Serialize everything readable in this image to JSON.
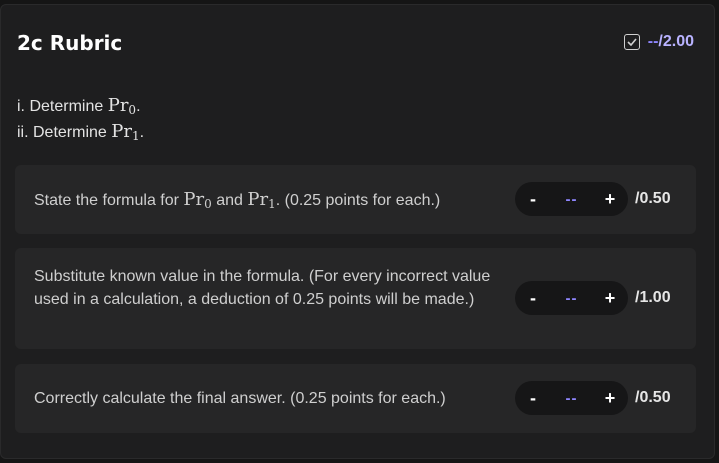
{
  "header": {
    "title": "2c Rubric",
    "score_placeholder": "--",
    "score_total": "/2.00"
  },
  "description": {
    "line1_prefix": "i. Determine ",
    "line1_math": "Pr",
    "line1_sub": "0",
    "line1_suffix": ".",
    "line2_prefix": "ii. Determine ",
    "line2_math": "Pr",
    "line2_sub": "1",
    "line2_suffix": "."
  },
  "items": [
    {
      "text_a": "State the formula for ",
      "math_a": "Pr",
      "sub_a": "0",
      "text_b": " and ",
      "math_b": "Pr",
      "sub_b": "1",
      "text_c": ". (0.25 points for each.)",
      "minus": "-",
      "value": "--",
      "plus": "+",
      "max": "/0.50"
    },
    {
      "text": "Substitute known value in the formula. (For every incorrect value used in a calculation, a deduction of 0.25 points will be made.)",
      "minus": "-",
      "value": "--",
      "plus": "+",
      "max": "/1.00"
    },
    {
      "text": "Correctly calculate the final answer. (0.25 points for each.)",
      "minus": "-",
      "value": "--",
      "plus": "+",
      "max": "/0.50"
    }
  ],
  "colors": {
    "accent": "#8f86ff",
    "background": "#1e1e1f",
    "card": "#262627"
  },
  "icons": {
    "score_icon": "checkbox-checked-icon"
  }
}
